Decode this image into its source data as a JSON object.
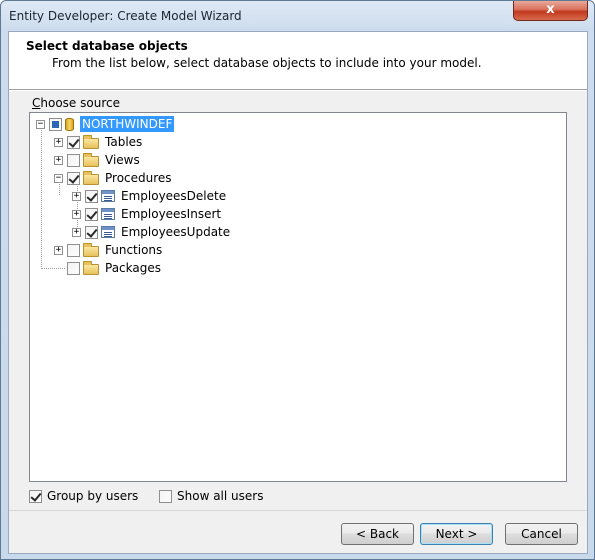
{
  "window": {
    "title": "Entity Developer: Create Model Wizard",
    "close_glyph": "x"
  },
  "header": {
    "title": "Select database objects",
    "subtitle": "From the list below, select database objects to include into your model."
  },
  "source": {
    "label_first": "C",
    "label_rest": "hoose source"
  },
  "tree": {
    "root": {
      "label": "NORTHWINDEF",
      "expander": "−"
    },
    "tables": {
      "label": "Tables",
      "expander": "+"
    },
    "views": {
      "label": "Views",
      "expander": "+"
    },
    "procedures": {
      "label": "Procedures",
      "expander": "−"
    },
    "procs": [
      {
        "label": "EmployeesDelete",
        "expander": "+"
      },
      {
        "label": "EmployeesInsert",
        "expander": "+"
      },
      {
        "label": "EmployeesUpdate",
        "expander": "+"
      }
    ],
    "functions": {
      "label": "Functions",
      "expander": "+"
    },
    "packages": {
      "label": "Packages"
    }
  },
  "options": {
    "group_by_users": "Group by users",
    "show_all_users": "Show all users"
  },
  "buttons": {
    "back": "< Back",
    "next": "Next >",
    "cancel": "Cancel"
  }
}
